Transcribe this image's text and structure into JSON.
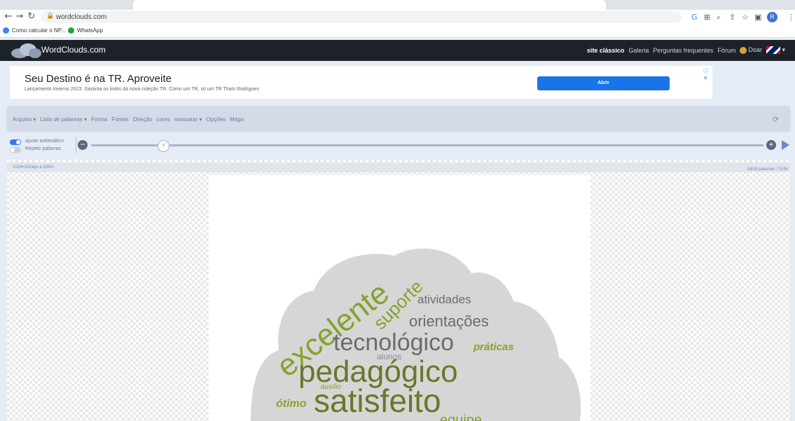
{
  "browser": {
    "url": "wordclouds.com",
    "bookmarks": [
      {
        "label": "Como calcular o NP...",
        "color": "#3b82f6"
      },
      {
        "label": "WhatsApp",
        "color": "#25a244"
      }
    ],
    "profile_initial": "R"
  },
  "site": {
    "logo_text": "WordClouds.com",
    "menu": [
      "site clássico",
      "Galeria",
      "Perguntas frequentes",
      "Fórum",
      "Doar"
    ]
  },
  "ad": {
    "title": "Seu Destino é na TR. Aproveite",
    "text": "Lançamento Inverno 2023. Garanta os looks da nova coleção TR. Como um TR, só um TR Thaís Rodrigues",
    "button": "Abrir",
    "choices": "ⓘ ✕"
  },
  "app": {
    "menu": [
      "Arquivo ▾",
      "Lista de palavras ▾",
      "Forma",
      "Fontes",
      "Direção",
      "cores",
      "mascarar ▾",
      "Opções",
      "Mago"
    ],
    "toggles": [
      {
        "label": "ajuste automático",
        "on": true
      },
      {
        "label": "Repetir palavras",
        "on": false
      }
    ],
    "slider_value": "6",
    "canvas_size": "1024×1024px a 100%",
    "word_count": "18/18 palavras ⓘ0.5s"
  },
  "wordcloud": {
    "colors": {
      "green": "#86a22d",
      "olive": "#69782a",
      "gray": "#6b6b6b",
      "shape": "#d6d6d6"
    },
    "words": [
      "excelente",
      "suporte",
      "atividades",
      "orientações",
      "tecnológico",
      "práticas",
      "alunos",
      "pedagógico",
      "auxílio",
      "ótimo",
      "satisfeito",
      "equipe"
    ]
  }
}
